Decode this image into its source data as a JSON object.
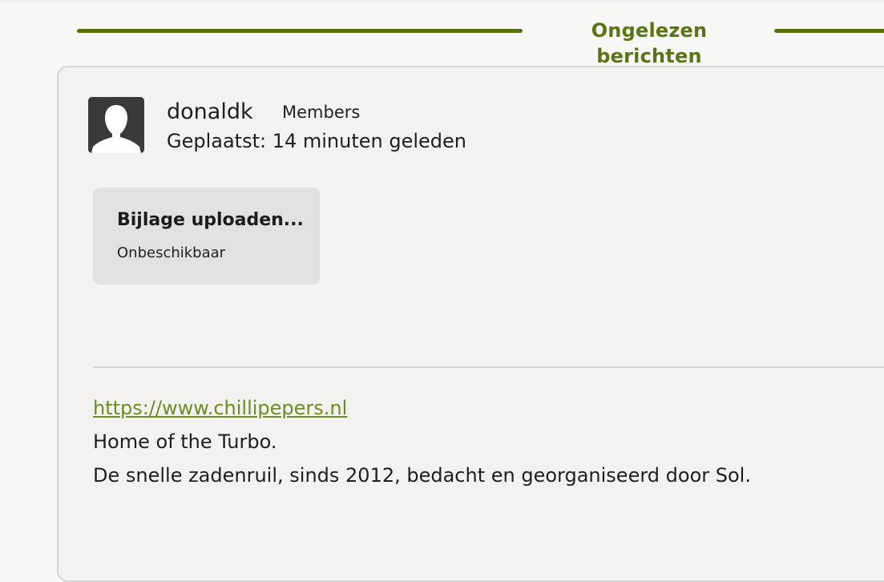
{
  "section_divider": {
    "label": "Ongelezen berichten",
    "accent_color": "#56720f"
  },
  "post": {
    "author": {
      "username": "donaldk",
      "group": "Members",
      "avatar_icon": "default-user-icon"
    },
    "posted_time": "Geplaatst: 14 minuten geleden",
    "attachment": {
      "title": "Bijlage uploaden...",
      "status": "Onbeschikbaar"
    },
    "signature": {
      "link": "https://www.chillipepers.nl",
      "line1": "Home of the Turbo.",
      "line2": "De snelle zadenruil, sinds 2012, bedacht en georganiseerd door Sol."
    }
  }
}
